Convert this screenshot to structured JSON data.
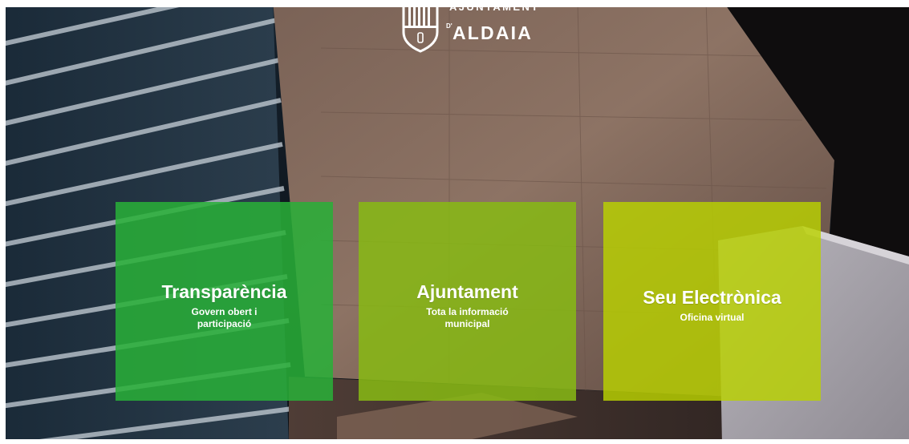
{
  "header": {
    "logo_text_top": "AJUNTAMENT",
    "logo_text_d": "D'",
    "logo_text_main": "ALDAIA"
  },
  "cards": [
    {
      "title": "Transparència",
      "subtitle": "Govern obert i participació",
      "color": "#29b038"
    },
    {
      "title": "Ajuntament",
      "subtitle": "Tota la informació municipal",
      "color": "#87b914"
    },
    {
      "title": "Seu Electrònica",
      "subtitle": "Oficina virtual",
      "color": "#b9d200"
    }
  ],
  "icons": {
    "logo": "shield-crest-icon"
  }
}
